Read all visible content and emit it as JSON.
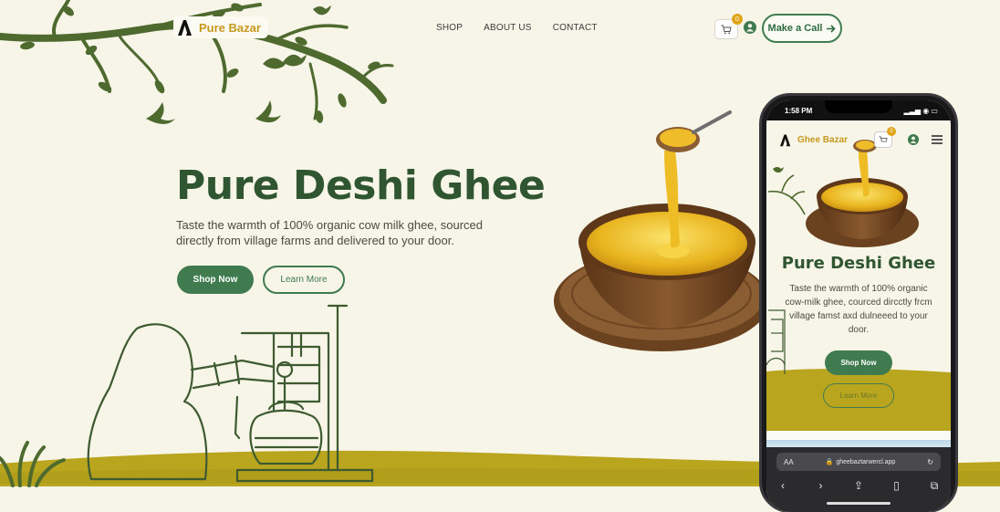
{
  "brand": {
    "name": "Pure Bazar",
    "accent": "#c79a1e",
    "primary": "#3f7b4f"
  },
  "nav": {
    "items": [
      "SHOP",
      "ABOUT US",
      "CONTACT"
    ]
  },
  "header": {
    "cart_count": "0",
    "call_label": "Make a Call"
  },
  "hero": {
    "title": "Pure Deshi Ghee",
    "subtitle": "Taste the warmth of 100% organic cow milk ghee, sourced directly from village farms and delivered to your door.",
    "shop_label": "Shop Now",
    "learn_label": "Learn More"
  },
  "phone": {
    "time": "1:58 PM",
    "brand": "Ghee Bazar",
    "cart_count": "0",
    "title": "Pure Deshi Ghee",
    "subtitle": "Taste the warmth of 100% organic cow-milk ghee, courced dircctly frcm village famst axd dulneeed to your door.",
    "shop_label": "Shop Now",
    "learn_label": "Learn More",
    "url": "gheebaztarwercl.app",
    "aa": "AA"
  }
}
